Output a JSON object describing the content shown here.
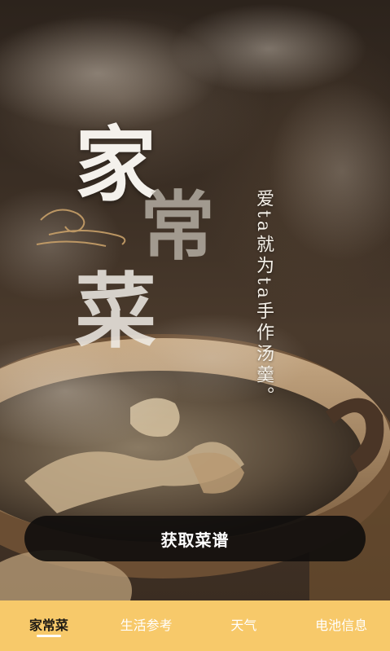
{
  "hero": {
    "title_chars": [
      "家",
      "常",
      "菜"
    ],
    "tagline": "爱ta就为ta手作汤羹。"
  },
  "cta": {
    "label": "获取菜谱"
  },
  "tabbar": {
    "tabs": [
      {
        "label": "家常菜",
        "active": true
      },
      {
        "label": "生活参考",
        "active": false
      },
      {
        "label": "天气",
        "active": false
      },
      {
        "label": "电池信息",
        "active": false
      }
    ]
  },
  "colors": {
    "tabbar_bg": "#f7c96a",
    "cta_bg": "#0f0d0c",
    "active_tab_text": "#1e1a14",
    "inactive_tab_text": "#ffffff"
  }
}
